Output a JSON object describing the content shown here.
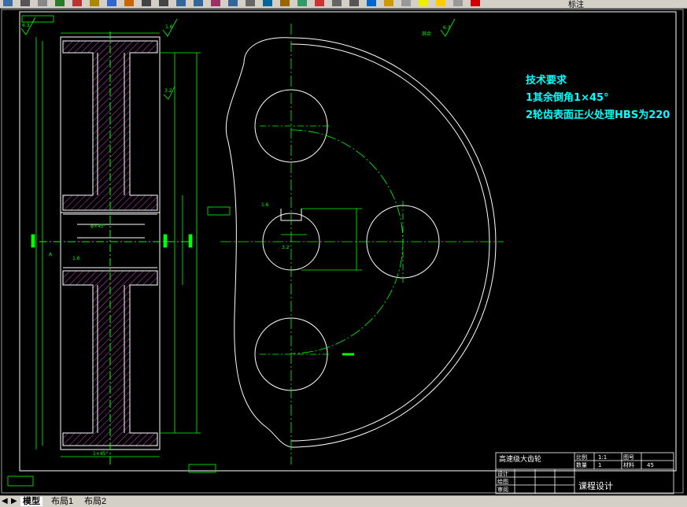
{
  "toolbar": {
    "layer_name": "标注",
    "buttons": [
      "save-icon",
      "print-icon",
      "preview-icon",
      "publish-icon",
      "cut-icon",
      "copy-icon",
      "paste-icon",
      "match-icon",
      "undo-icon",
      "redo-icon",
      "pan-icon",
      "zoom-realtime-icon",
      "zoom-window-icon",
      "zoom-previous-icon",
      "properties-icon",
      "design-center-icon",
      "tool-palette-icon",
      "sheet-set-icon",
      "markup-icon",
      "calc-icon",
      "table-icon",
      "help-icon",
      "layer-icon",
      "layer-state-icon",
      "bulb-icon",
      "sun-icon",
      "lock-icon",
      "color-icon"
    ]
  },
  "drawing": {
    "notes": {
      "title": "技术要求",
      "line1": "1其余倒角1×45°",
      "line2": "2轮齿表面正火处理HBS为220"
    },
    "roughness_top": "6.3",
    "roughness_left": "3.2",
    "roughness_hub": "1.6",
    "roughness_bore": "3.2",
    "small_label": "其余",
    "dim_label_mid": "φ×45°",
    "dim_label_bottom": "1×45°",
    "datum_label": "A",
    "title_block": {
      "part_name": "高速级大齿轮",
      "scale_label": "比例",
      "scale_value": "1:1",
      "qty_label": "数量",
      "qty_value": "1",
      "drawing_no_label": "图号",
      "material_label": "材料",
      "material_value": "45",
      "designer_label": "设计",
      "drafter_label": "绘图",
      "reviewer_label": "审阅",
      "course_label": "课程设计"
    }
  },
  "tabs": {
    "model": "模型",
    "layout1": "布局1",
    "layout2": "布局2"
  },
  "nav_arrows": [
    "◀",
    "▶"
  ],
  "colors": {
    "lines_white": "#ffffff",
    "dims_green": "#00ff00",
    "hatch_magenta": "#cc44cc",
    "notes_cyan": "#00ffff",
    "frame_green": "#00ff00"
  }
}
